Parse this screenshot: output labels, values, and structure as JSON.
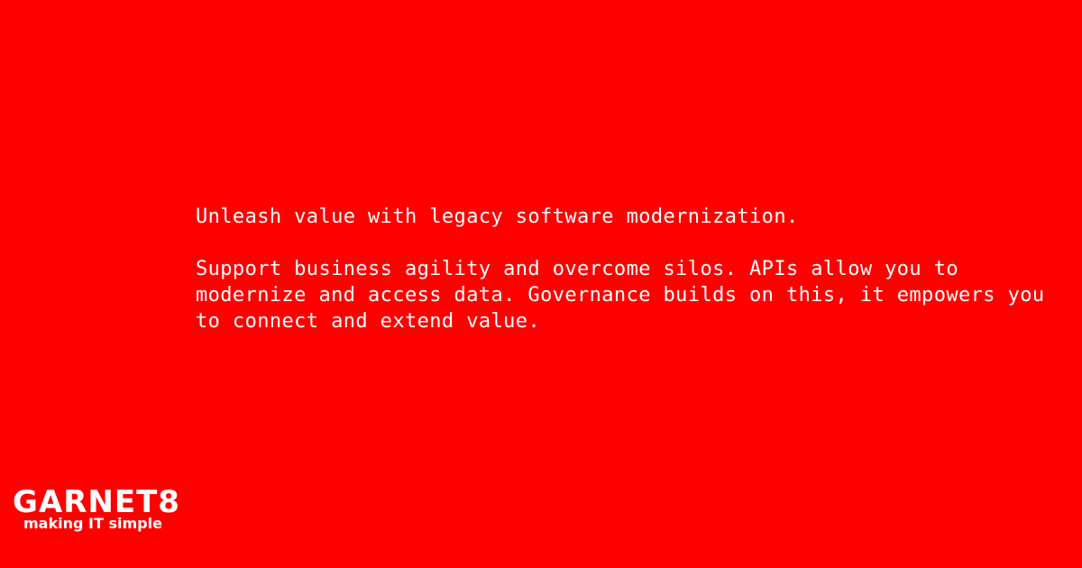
{
  "background_color": "#ff0000",
  "text_color": "#ffffff",
  "message": {
    "headline": "Unleash value with legacy software modernization.",
    "body": "Support business agility and overcome silos. APIs allow you to modernize and access data. Governance builds on this, it empowers you to connect and extend value."
  },
  "brand": {
    "name": "GARNET8",
    "tagline": "making IT simple"
  }
}
